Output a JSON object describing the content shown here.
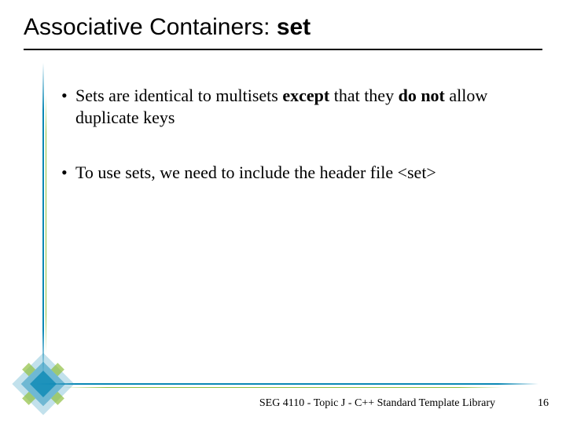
{
  "title": {
    "prefix": "Associative Containers: ",
    "bold": "set"
  },
  "bullets": [
    {
      "runs": [
        {
          "t": "Sets are identical to multisets ",
          "b": false
        },
        {
          "t": "except",
          "b": true
        },
        {
          "t": " that they ",
          "b": false
        },
        {
          "t": "do not",
          "b": true
        },
        {
          "t": " allow duplicate keys",
          "b": false
        }
      ]
    },
    {
      "runs": [
        {
          "t": "To use sets, we need to include the header file <set>",
          "b": false
        }
      ]
    }
  ],
  "footer": "SEG 4110 - Topic J - C++ Standard Template Library",
  "page": "16",
  "colors": {
    "teal": "#0a88b5",
    "green": "#8fbf3f"
  }
}
